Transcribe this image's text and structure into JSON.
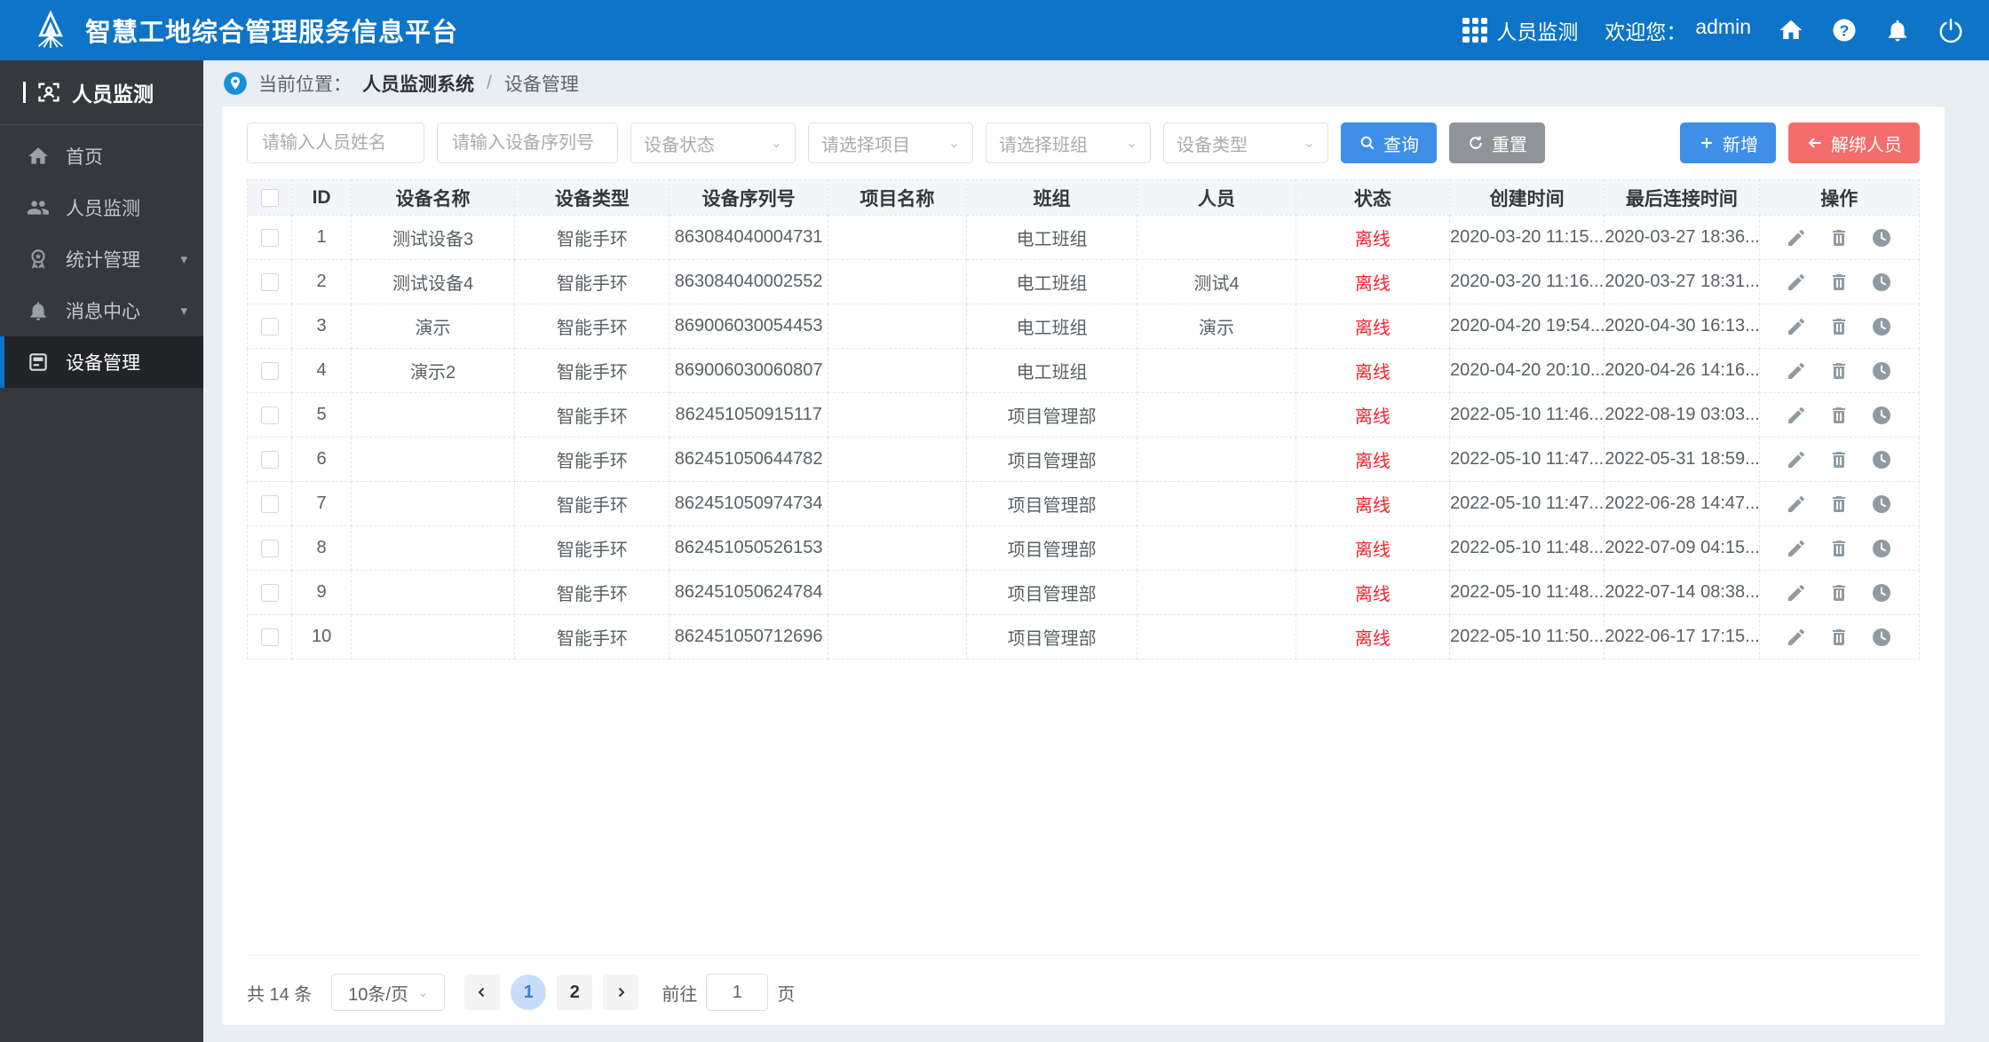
{
  "colors": {
    "primary_blue": "#0d74c8",
    "button_blue": "#3d8fe8",
    "danger_red": "#f56c6c",
    "status_offline_red": "#f5222d",
    "reset_gray": "#909399",
    "sidebar_bg": "#35383d"
  },
  "navbar": {
    "title": "智慧工地综合管理服务信息平台",
    "app_switcher": "人员监测",
    "welcome": "欢迎您：",
    "username": "admin"
  },
  "sidebar": {
    "header": "人员监测",
    "items": [
      {
        "label": "首页"
      },
      {
        "label": "人员监测"
      },
      {
        "label": "统计管理"
      },
      {
        "label": "消息中心"
      },
      {
        "label": "设备管理"
      }
    ]
  },
  "breadcrumb": {
    "prefix": "当前位置：",
    "root": "人员监测系统",
    "separator": "/",
    "current": "设备管理"
  },
  "filters": {
    "name_placeholder": "请输入人员姓名",
    "serial_placeholder": "请输入设备序列号",
    "selects": [
      "设备状态",
      "请选择项目",
      "请选择班组",
      "设备类型"
    ],
    "search_label": "查询",
    "reset_label": "重置",
    "add_label": "新增",
    "unbind_label": "解绑人员"
  },
  "table": {
    "headers": [
      "ID",
      "设备名称",
      "设备类型",
      "设备序列号",
      "项目名称",
      "班组",
      "人员",
      "状态",
      "创建时间",
      "最后连接时间",
      "操作"
    ],
    "rows": [
      {
        "id": "1",
        "name": "测试设备3",
        "type": "智能手环",
        "serial": "863084040004731",
        "project": "",
        "team": "电工班组",
        "person": "",
        "status": "离线",
        "created": "2020-03-20 11:15...",
        "last": "2020-03-27 18:36..."
      },
      {
        "id": "2",
        "name": "测试设备4",
        "type": "智能手环",
        "serial": "863084040002552",
        "project": "",
        "team": "电工班组",
        "person": "测试4",
        "status": "离线",
        "created": "2020-03-20 11:16...",
        "last": "2020-03-27 18:31..."
      },
      {
        "id": "3",
        "name": "演示",
        "type": "智能手环",
        "serial": "869006030054453",
        "project": "",
        "team": "电工班组",
        "person": "演示",
        "status": "离线",
        "created": "2020-04-20 19:54...",
        "last": "2020-04-30 16:13..."
      },
      {
        "id": "4",
        "name": "演示2",
        "type": "智能手环",
        "serial": "869006030060807",
        "project": "",
        "team": "电工班组",
        "person": "",
        "status": "离线",
        "created": "2020-04-20 20:10...",
        "last": "2020-04-26 14:16..."
      },
      {
        "id": "5",
        "name": "",
        "type": "智能手环",
        "serial": "862451050915117",
        "project": "",
        "team": "项目管理部",
        "person": "",
        "status": "离线",
        "created": "2022-05-10 11:46...",
        "last": "2022-08-19 03:03..."
      },
      {
        "id": "6",
        "name": "",
        "type": "智能手环",
        "serial": "862451050644782",
        "project": "",
        "team": "项目管理部",
        "person": "",
        "status": "离线",
        "created": "2022-05-10 11:47...",
        "last": "2022-05-31 18:59..."
      },
      {
        "id": "7",
        "name": "",
        "type": "智能手环",
        "serial": "862451050974734",
        "project": "",
        "team": "项目管理部",
        "person": "",
        "status": "离线",
        "created": "2022-05-10 11:47...",
        "last": "2022-06-28 14:47..."
      },
      {
        "id": "8",
        "name": "",
        "type": "智能手环",
        "serial": "862451050526153",
        "project": "",
        "team": "项目管理部",
        "person": "",
        "status": "离线",
        "created": "2022-05-10 11:48...",
        "last": "2022-07-09 04:15..."
      },
      {
        "id": "9",
        "name": "",
        "type": "智能手环",
        "serial": "862451050624784",
        "project": "",
        "team": "项目管理部",
        "person": "",
        "status": "离线",
        "created": "2022-05-10 11:48...",
        "last": "2022-07-14 08:38..."
      },
      {
        "id": "10",
        "name": "",
        "type": "智能手环",
        "serial": "862451050712696",
        "project": "",
        "team": "项目管理部",
        "person": "",
        "status": "离线",
        "created": "2022-05-10 11:50...",
        "last": "2022-06-17 17:15..."
      }
    ]
  },
  "pagination": {
    "total": "共 14 条",
    "page_size": "10条/页",
    "pages": [
      "1",
      "2"
    ],
    "active_page": "1",
    "goto_label": "前往",
    "goto_value": "1",
    "page_label": "页"
  }
}
